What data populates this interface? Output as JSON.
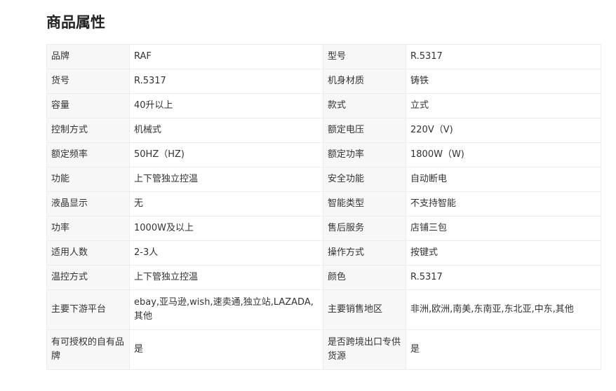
{
  "section_title": "商品属性",
  "rows": [
    {
      "k1": "品牌",
      "v1": "RAF",
      "k2": "型号",
      "v2": "R.5317"
    },
    {
      "k1": "货号",
      "v1": "R.5317",
      "k2": "机身材质",
      "v2": "铸铁"
    },
    {
      "k1": "容量",
      "v1": "40升以上",
      "k2": "款式",
      "v2": "立式"
    },
    {
      "k1": "控制方式",
      "v1": "机械式",
      "k2": "额定电压",
      "v2": "220V（V)"
    },
    {
      "k1": "额定频率",
      "v1": "50HZ（HZ)",
      "k2": "额定功率",
      "v2": "1800W（W)"
    },
    {
      "k1": "功能",
      "v1": "上下管独立控温",
      "k2": "安全功能",
      "v2": "自动断电"
    },
    {
      "k1": "液晶显示",
      "v1": "无",
      "k2": "智能类型",
      "v2": "不支持智能"
    },
    {
      "k1": "功率",
      "v1": "1000W及以上",
      "k2": "售后服务",
      "v2": "店铺三包"
    },
    {
      "k1": "适用人数",
      "v1": "2-3人",
      "k2": "操作方式",
      "v2": "按键式"
    },
    {
      "k1": "温控方式",
      "v1": "上下管独立控温",
      "k2": "颜色",
      "v2": "R.5317"
    },
    {
      "k1": "主要下游平台",
      "v1": "ebay,亚马逊,wish,速卖通,独立站,LAZADA,其他",
      "k2": "主要销售地区",
      "v2": "非洲,欧洲,南美,东南亚,东北亚,中东,其他"
    },
    {
      "k1": "有可授权的自有品牌",
      "v1": "是",
      "k2": "是否跨境出口专供货源",
      "v2": "是"
    }
  ]
}
